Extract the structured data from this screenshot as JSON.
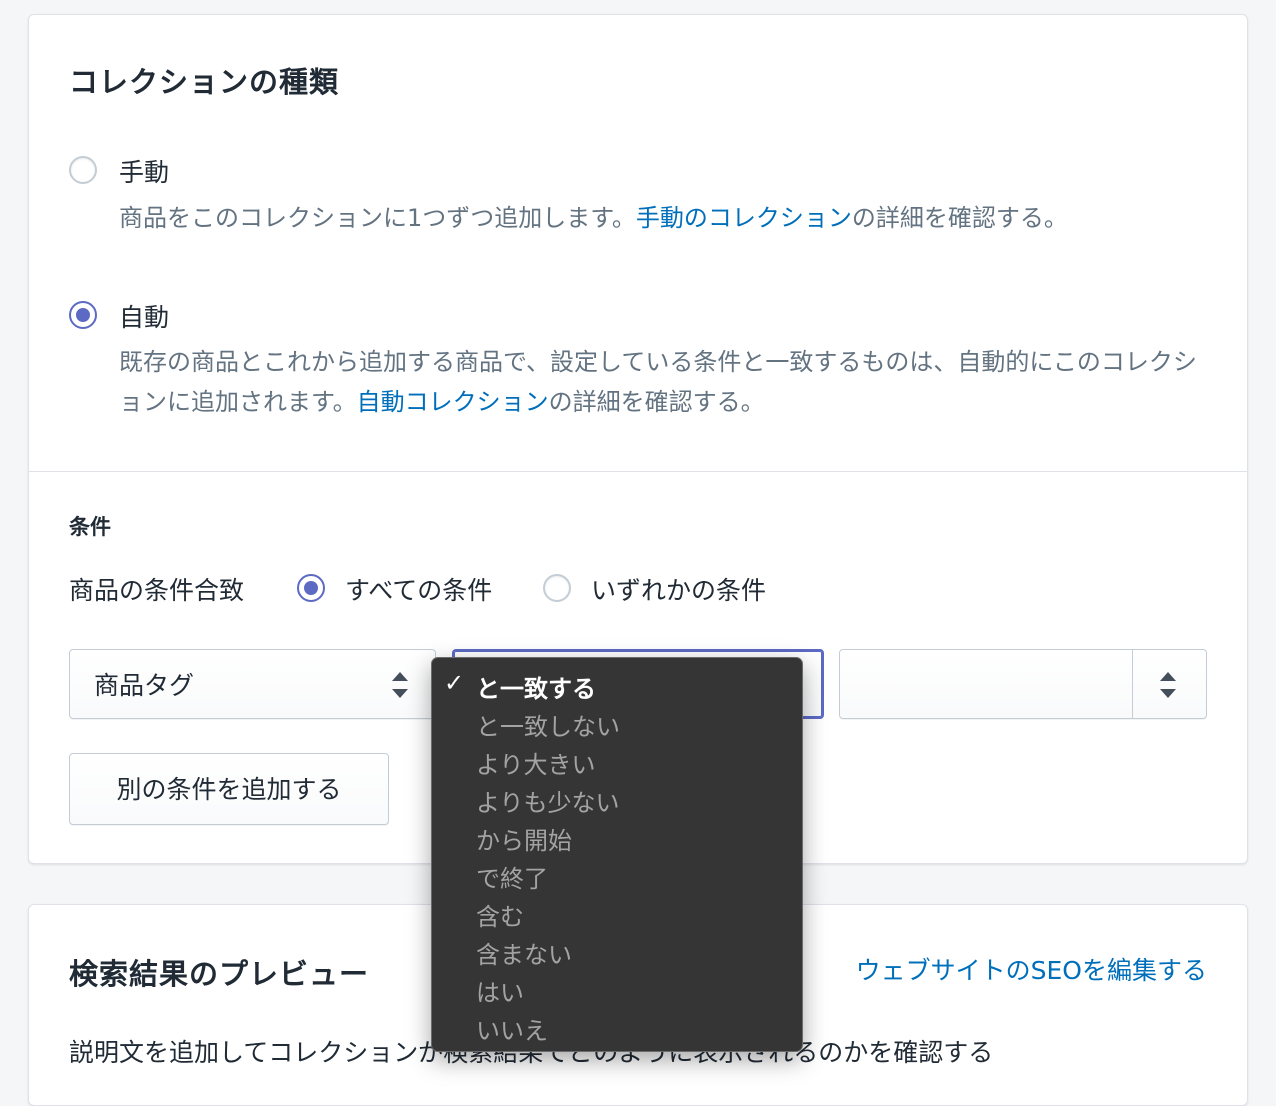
{
  "collection_type": {
    "title": "コレクションの種類",
    "manual": {
      "label": "手動",
      "desc_before": "商品をこのコレクションに1つずつ追加します。",
      "desc_link": "手動のコレクション",
      "desc_after": "の詳細を確認する。",
      "selected": false
    },
    "auto": {
      "label": "自動",
      "desc_before": "既存の商品とこれから追加する商品で、設定している条件と一致するものは、自動的にこのコレクションに追加されます。",
      "desc_link": "自動コレクション",
      "desc_after": "の詳細を確認する。",
      "selected": true
    }
  },
  "conditions": {
    "title": "条件",
    "match_label": "商品の条件合致",
    "match_all": {
      "label": "すべての条件",
      "selected": true
    },
    "match_any": {
      "label": "いずれかの条件",
      "selected": false
    },
    "field_select": "商品タグ",
    "operator_select": "と一致する",
    "value_input": "",
    "add_button": "別の条件を追加する"
  },
  "operator_menu": {
    "selected_index": 0,
    "items": [
      "と一致する",
      "と一致しない",
      "より大きい",
      "よりも少ない",
      "から開始",
      "で終了",
      "含む",
      "含まない",
      "はい",
      "いいえ"
    ]
  },
  "seo_preview": {
    "title": "検索結果のプレビュー",
    "edit_link": "ウェブサイトのSEOを編集する",
    "description": "説明文を追加してコレクションが検索結果でどのように表示されるのかを確認する"
  },
  "colors": {
    "accent": "#5c6ac4",
    "link": "#006fbb",
    "menu_bg": "#353535"
  }
}
